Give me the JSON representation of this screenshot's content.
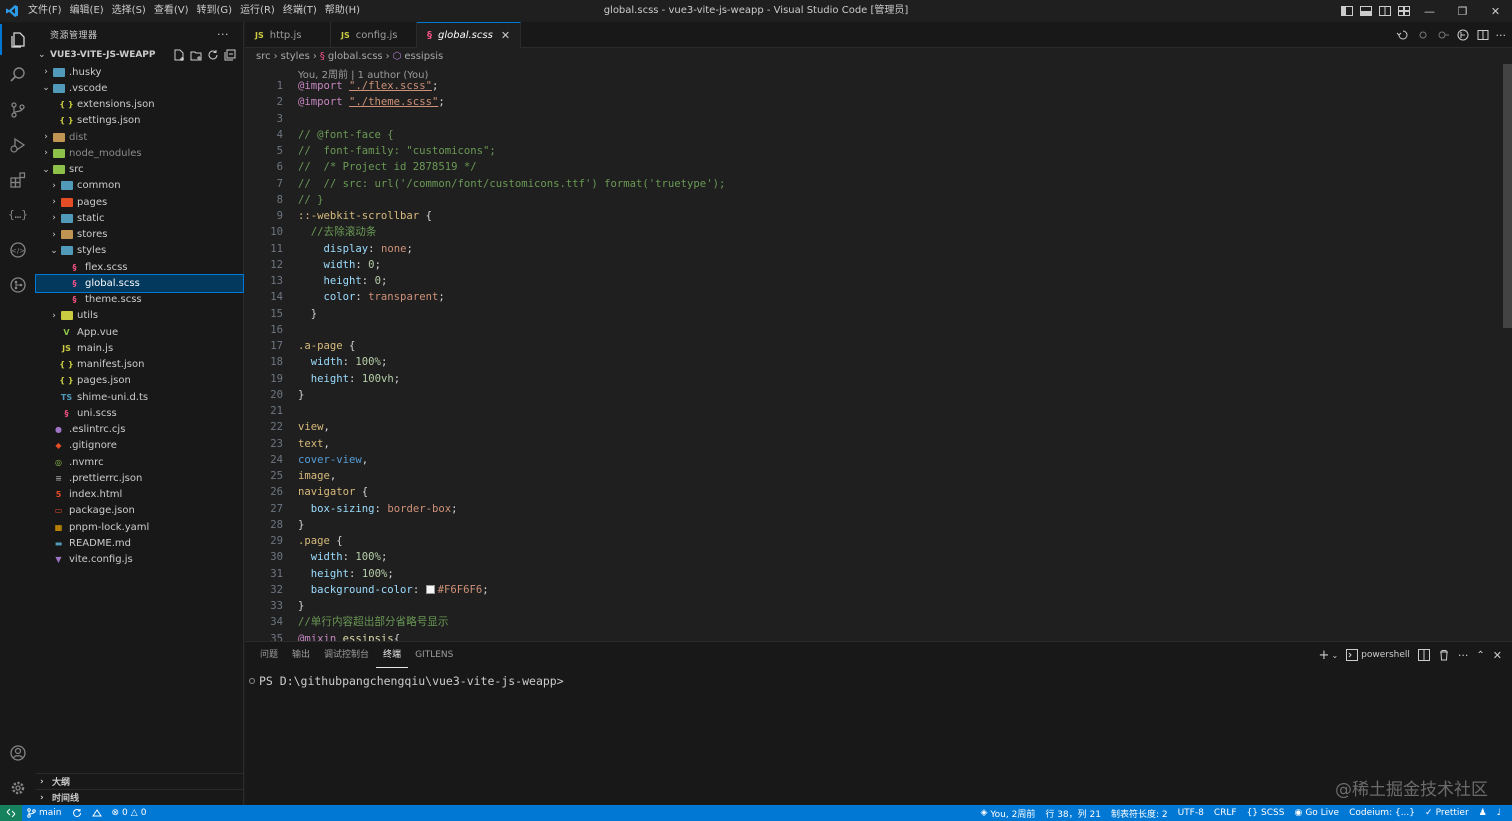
{
  "titlebar": {
    "menu": [
      "文件(F)",
      "编辑(E)",
      "选择(S)",
      "查看(V)",
      "转到(G)",
      "运行(R)",
      "终端(T)",
      "帮助(H)"
    ],
    "title": "global.scss - vue3-vite-js-weapp - Visual Studio Code [管理员]"
  },
  "sidebar": {
    "header": "资源管理器",
    "more": "···",
    "project": "VUE3-VITE-JS-WEAPP",
    "tree": [
      {
        "label": ".husky",
        "depth": 1,
        "type": "folder",
        "open": false,
        "color": "#519aba"
      },
      {
        "label": ".vscode",
        "depth": 1,
        "type": "folder",
        "open": true,
        "color": "#519aba"
      },
      {
        "label": "extensions.json",
        "depth": 2,
        "type": "json"
      },
      {
        "label": "settings.json",
        "depth": 2,
        "type": "json"
      },
      {
        "label": "dist",
        "depth": 1,
        "type": "folder",
        "open": false,
        "color": "#c09553",
        "dim": true
      },
      {
        "label": "node_modules",
        "depth": 1,
        "type": "folder",
        "open": false,
        "color": "#8dc149",
        "dim": true
      },
      {
        "label": "src",
        "depth": 1,
        "type": "folder",
        "open": true,
        "color": "#8dc149"
      },
      {
        "label": "common",
        "depth": 2,
        "type": "folder",
        "open": false,
        "color": "#519aba"
      },
      {
        "label": "pages",
        "depth": 2,
        "type": "folder",
        "open": false,
        "color": "#e44d26"
      },
      {
        "label": "static",
        "depth": 2,
        "type": "folder",
        "open": false,
        "color": "#519aba"
      },
      {
        "label": "stores",
        "depth": 2,
        "type": "folder",
        "open": false,
        "color": "#c09553"
      },
      {
        "label": "styles",
        "depth": 2,
        "type": "folder",
        "open": true,
        "color": "#519aba"
      },
      {
        "label": "flex.scss",
        "depth": 3,
        "type": "scss"
      },
      {
        "label": "global.scss",
        "depth": 3,
        "type": "scss",
        "selected": true
      },
      {
        "label": "theme.scss",
        "depth": 3,
        "type": "scss"
      },
      {
        "label": "utils",
        "depth": 2,
        "type": "folder",
        "open": false,
        "color": "#cbcb41"
      },
      {
        "label": "App.vue",
        "depth": 2,
        "type": "vue"
      },
      {
        "label": "main.js",
        "depth": 2,
        "type": "js"
      },
      {
        "label": "manifest.json",
        "depth": 2,
        "type": "json"
      },
      {
        "label": "pages.json",
        "depth": 2,
        "type": "json"
      },
      {
        "label": "shime-uni.d.ts",
        "depth": 2,
        "type": "ts"
      },
      {
        "label": "uni.scss",
        "depth": 2,
        "type": "scss"
      },
      {
        "label": ".eslintrc.cjs",
        "depth": 1,
        "type": "eslint"
      },
      {
        "label": ".gitignore",
        "depth": 1,
        "type": "git"
      },
      {
        "label": ".nvmrc",
        "depth": 1,
        "type": "nvm"
      },
      {
        "label": ".prettierrc.json",
        "depth": 1,
        "type": "prettier"
      },
      {
        "label": "index.html",
        "depth": 1,
        "type": "html"
      },
      {
        "label": "package.json",
        "depth": 1,
        "type": "npm"
      },
      {
        "label": "pnpm-lock.yaml",
        "depth": 1,
        "type": "pnpm"
      },
      {
        "label": "README.md",
        "depth": 1,
        "type": "md"
      },
      {
        "label": "vite.config.js",
        "depth": 1,
        "type": "vite"
      }
    ],
    "outline": "大纲",
    "timeline": "时间线"
  },
  "tabs": [
    {
      "icon": "JS",
      "label": "http.js",
      "active": false
    },
    {
      "icon": "JS",
      "label": "config.js",
      "active": false
    },
    {
      "icon": "scss",
      "label": "global.scss",
      "active": true
    }
  ],
  "breadcrumb": [
    "src",
    "styles",
    "global.scss",
    "essipsis"
  ],
  "editor": {
    "blame": "You, 2周前 | 1 author (You)",
    "lines": [
      [
        [
          "k",
          "@import "
        ],
        [
          "s",
          "\"./flex.scss\""
        ],
        [
          "w",
          ";"
        ]
      ],
      [
        [
          "k",
          "@import "
        ],
        [
          "s",
          "\"./theme.scss\""
        ],
        [
          "w",
          ";"
        ]
      ],
      [],
      [
        [
          "c",
          "// @font-face {"
        ]
      ],
      [
        [
          "c",
          "//  font-family: \"customicons\";"
        ]
      ],
      [
        [
          "c",
          "//  /* Project id 2878519 */"
        ]
      ],
      [
        [
          "c",
          "//  // src: url('/common/font/customicons.ttf') format('truetype');"
        ]
      ],
      [
        [
          "c",
          "// }"
        ]
      ],
      [
        [
          "sel",
          "::-webkit-scrollbar"
        ],
        [
          "w",
          " {"
        ]
      ],
      [
        [
          "w",
          "  "
        ],
        [
          "c",
          "//去除滚动条"
        ]
      ],
      [
        [
          "w",
          "    "
        ],
        [
          "p",
          "display"
        ],
        [
          "w",
          ": "
        ],
        [
          "v",
          "none"
        ],
        [
          "w",
          ";"
        ]
      ],
      [
        [
          "w",
          "    "
        ],
        [
          "p",
          "width"
        ],
        [
          "w",
          ": "
        ],
        [
          "n",
          "0"
        ],
        [
          "w",
          ";"
        ]
      ],
      [
        [
          "w",
          "    "
        ],
        [
          "p",
          "height"
        ],
        [
          "w",
          ": "
        ],
        [
          "n",
          "0"
        ],
        [
          "w",
          ";"
        ]
      ],
      [
        [
          "w",
          "    "
        ],
        [
          "p",
          "color"
        ],
        [
          "w",
          ": "
        ],
        [
          "v",
          "transparent"
        ],
        [
          "w",
          ";"
        ]
      ],
      [
        [
          "w",
          "  }"
        ]
      ],
      [],
      [
        [
          "sel",
          ".a-page"
        ],
        [
          "w",
          " {"
        ]
      ],
      [
        [
          "w",
          "  "
        ],
        [
          "p",
          "width"
        ],
        [
          "w",
          ": "
        ],
        [
          "n",
          "100%"
        ],
        [
          "w",
          ";"
        ]
      ],
      [
        [
          "w",
          "  "
        ],
        [
          "p",
          "height"
        ],
        [
          "w",
          ": "
        ],
        [
          "n",
          "100vh"
        ],
        [
          "w",
          ";"
        ]
      ],
      [
        [
          "w",
          "}"
        ]
      ],
      [],
      [
        [
          "sel",
          "view"
        ],
        [
          "w",
          ","
        ]
      ],
      [
        [
          "sel",
          "text"
        ],
        [
          "w",
          ","
        ]
      ],
      [
        [
          "t",
          "cover-view"
        ],
        [
          "w",
          ","
        ]
      ],
      [
        [
          "sel",
          "image"
        ],
        [
          "w",
          ","
        ]
      ],
      [
        [
          "sel",
          "navigator"
        ],
        [
          "w",
          " {"
        ]
      ],
      [
        [
          "w",
          "  "
        ],
        [
          "p",
          "box-sizing"
        ],
        [
          "w",
          ": "
        ],
        [
          "v",
          "border-box"
        ],
        [
          "w",
          ";"
        ]
      ],
      [
        [
          "w",
          "}"
        ]
      ],
      [
        [
          "sel",
          ".page"
        ],
        [
          "w",
          " {"
        ]
      ],
      [
        [
          "w",
          "  "
        ],
        [
          "p",
          "width"
        ],
        [
          "w",
          ": "
        ],
        [
          "n",
          "100%"
        ],
        [
          "w",
          ";"
        ]
      ],
      [
        [
          "w",
          "  "
        ],
        [
          "p",
          "height"
        ],
        [
          "w",
          ": "
        ],
        [
          "n",
          "100%"
        ],
        [
          "w",
          ";"
        ]
      ],
      [
        [
          "w",
          "  "
        ],
        [
          "p",
          "background-color"
        ],
        [
          "w",
          ": "
        ],
        [
          "swatch",
          ""
        ],
        [
          "v",
          "#F6F6F6"
        ],
        [
          "w",
          ";"
        ]
      ],
      [
        [
          "w",
          "}"
        ]
      ],
      [
        [
          "c",
          "//单行内容超出部分省略号显示"
        ]
      ],
      [
        [
          "k",
          "@mixin "
        ],
        [
          "f",
          "essipsis"
        ],
        [
          "w",
          "{"
        ]
      ]
    ]
  },
  "panel": {
    "tabs": [
      "问题",
      "输出",
      "调试控制台",
      "终端",
      "GITLENS"
    ],
    "active_tab": "终端",
    "terminal_name": "powershell",
    "prompt": "PS D:\\githubpangchengqiu\\vue3-vite-js-weapp>"
  },
  "watermark": "@稀土掘金技术社区",
  "statusbar": {
    "branch": "main",
    "errors": "0",
    "warnings": "0",
    "blame": "You, 2周前",
    "position": "行 38，列 21",
    "tabsize": "制表符长度: 2",
    "encoding": "UTF-8",
    "eol": "CRLF",
    "language": "SCSS",
    "golive": "Go Live",
    "codeium": "Codeium: {...}",
    "prettier": "Prettier"
  },
  "colors": {
    "accent": "#0078d4",
    "statusbar": "#0078d4",
    "remote": "#16825d"
  }
}
